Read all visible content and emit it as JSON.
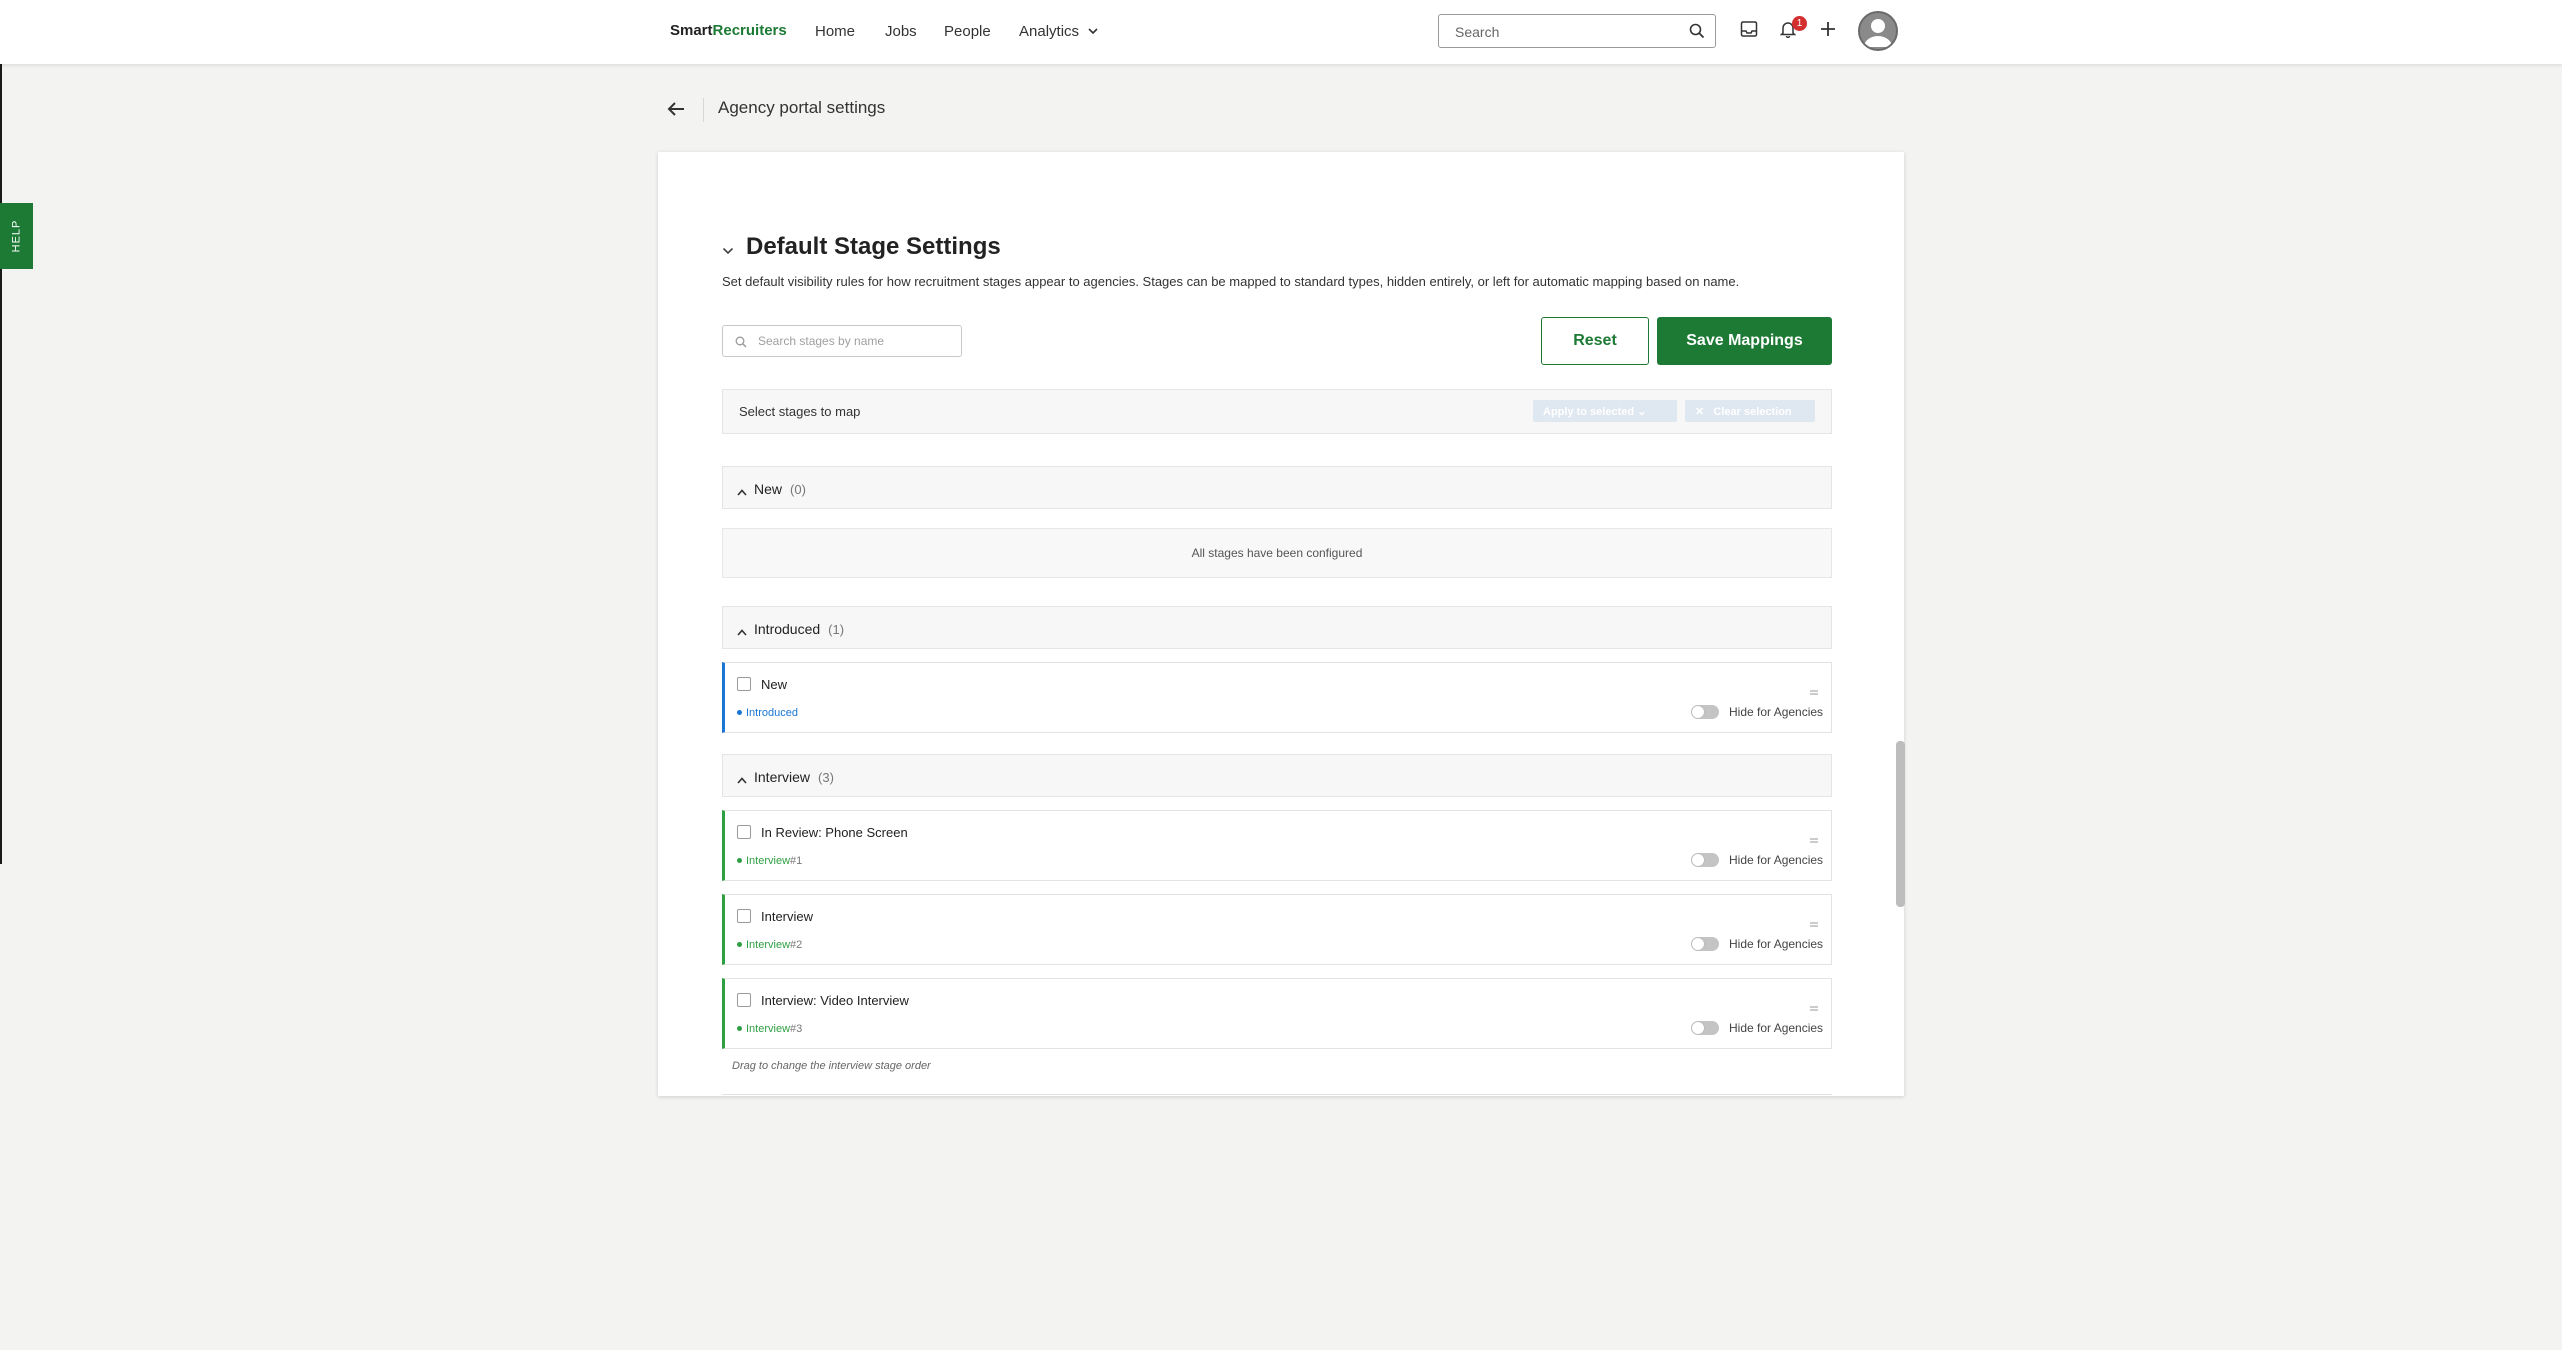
{
  "nav": {
    "logo_smart": "Smart",
    "logo_recruiters": "Recruiters",
    "links": [
      "Home",
      "Jobs",
      "People"
    ],
    "analytics": "Analytics",
    "search_placeholder": "Search",
    "notification_count": "1"
  },
  "help_tab": "HELP",
  "page": {
    "title": "Agency portal settings"
  },
  "section": {
    "title": "Default Stage Settings",
    "description": "Set default visibility rules for how recruitment stages appear to agencies. Stages can be mapped to standard types, hidden entirely, or left for automatic mapping based on name.",
    "search_placeholder": "Search stages by name",
    "reset_label": "Reset",
    "save_label": "Save Mappings",
    "bulk_label": "Select stages to map",
    "apply_label": "Apply to selected",
    "clear_label": "Clear selection"
  },
  "groups": [
    {
      "name": "New",
      "count": "(0)",
      "empty_text": "All stages have been configured"
    },
    {
      "name": "Introduced",
      "count": "(1)"
    },
    {
      "name": "Interview",
      "count": "(3)"
    }
  ],
  "stages": [
    {
      "name": "New",
      "type": "Introduced",
      "num": "",
      "hide_label": "Hide for Agencies",
      "hidden": false
    },
    {
      "name": "In Review: Phone Screen",
      "type": "Interview",
      "num": "#1",
      "hide_label": "Hide for Agencies",
      "hidden": false
    },
    {
      "name": "Interview",
      "type": "Interview",
      "num": "#2",
      "hide_label": "Hide for Agencies",
      "hidden": false
    },
    {
      "name": "Interview: Video Interview",
      "type": "Interview",
      "num": "#3",
      "hide_label": "Hide for Agencies",
      "hidden": false
    }
  ],
  "drag_hint": "Drag to change the interview stage order",
  "colors": {
    "brand_green": "#1d7a35",
    "introduced_blue": "#1976d2",
    "interview_green": "#2ea043"
  }
}
